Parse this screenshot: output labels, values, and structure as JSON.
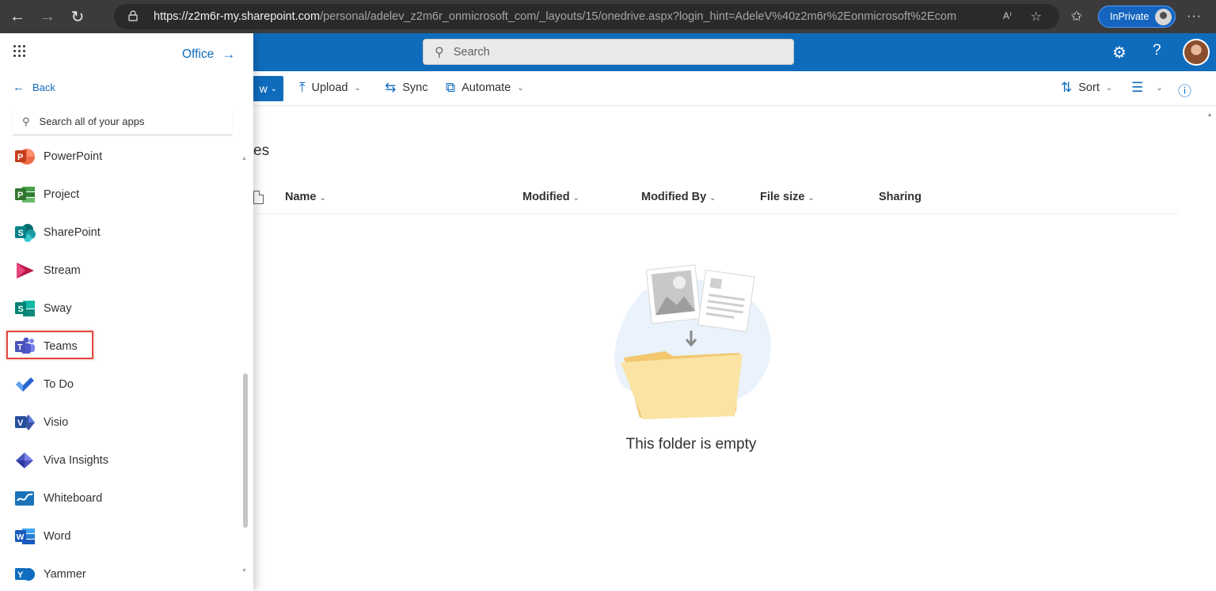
{
  "browser": {
    "url_host": "https://z2m6r-my.sharepoint.com",
    "url_path": "/personal/adelev_z2m6r_onmicrosoft_com/_layouts/15/onedrive.aspx?login_hint=AdeleV%40z2m6r%2Eonmicrosoft%2Ecom",
    "inprivate_label": "InPrivate",
    "read_aloud": "A⁾"
  },
  "suite": {
    "search_placeholder": "Search"
  },
  "commands": {
    "new_label": "w",
    "upload": "Upload",
    "sync": "Sync",
    "automate": "Automate",
    "sort": "Sort"
  },
  "main": {
    "breadcrumb_fragment": "es",
    "columns": [
      "Name",
      "Modified",
      "Modified By",
      "File size",
      "Sharing"
    ],
    "empty_message": "This folder is empty"
  },
  "launcher": {
    "office_link": "Office",
    "back_label": "Back",
    "search_placeholder": "Search all of your apps",
    "apps": [
      {
        "name": "PowerPoint",
        "icon": "powerpoint-icon",
        "color": "#c43e1c"
      },
      {
        "name": "Project",
        "icon": "project-icon",
        "color": "#31752f"
      },
      {
        "name": "SharePoint",
        "icon": "sharepoint-icon",
        "color": "#038387"
      },
      {
        "name": "Stream",
        "icon": "stream-icon",
        "color": "#bc1948"
      },
      {
        "name": "Sway",
        "icon": "sway-icon",
        "color": "#008272"
      },
      {
        "name": "Teams",
        "icon": "teams-icon",
        "color": "#5b5fc7"
      },
      {
        "name": "To Do",
        "icon": "todo-icon",
        "color": "#2564cf"
      },
      {
        "name": "Visio",
        "icon": "visio-icon",
        "color": "#3955a3"
      },
      {
        "name": "Viva Insights",
        "icon": "viva-insights-icon",
        "color": "#4b53bc"
      },
      {
        "name": "Whiteboard",
        "icon": "whiteboard-icon",
        "color": "#1a73b8"
      },
      {
        "name": "Word",
        "icon": "word-icon",
        "color": "#185abd"
      },
      {
        "name": "Yammer",
        "icon": "yammer-icon",
        "color": "#106ebe"
      }
    ],
    "highlighted_app": "Teams"
  },
  "colors": {
    "brand_blue": "#0f6cbd",
    "browser_dark": "#3b3b3b",
    "highlight_red": "#e04a3f"
  }
}
